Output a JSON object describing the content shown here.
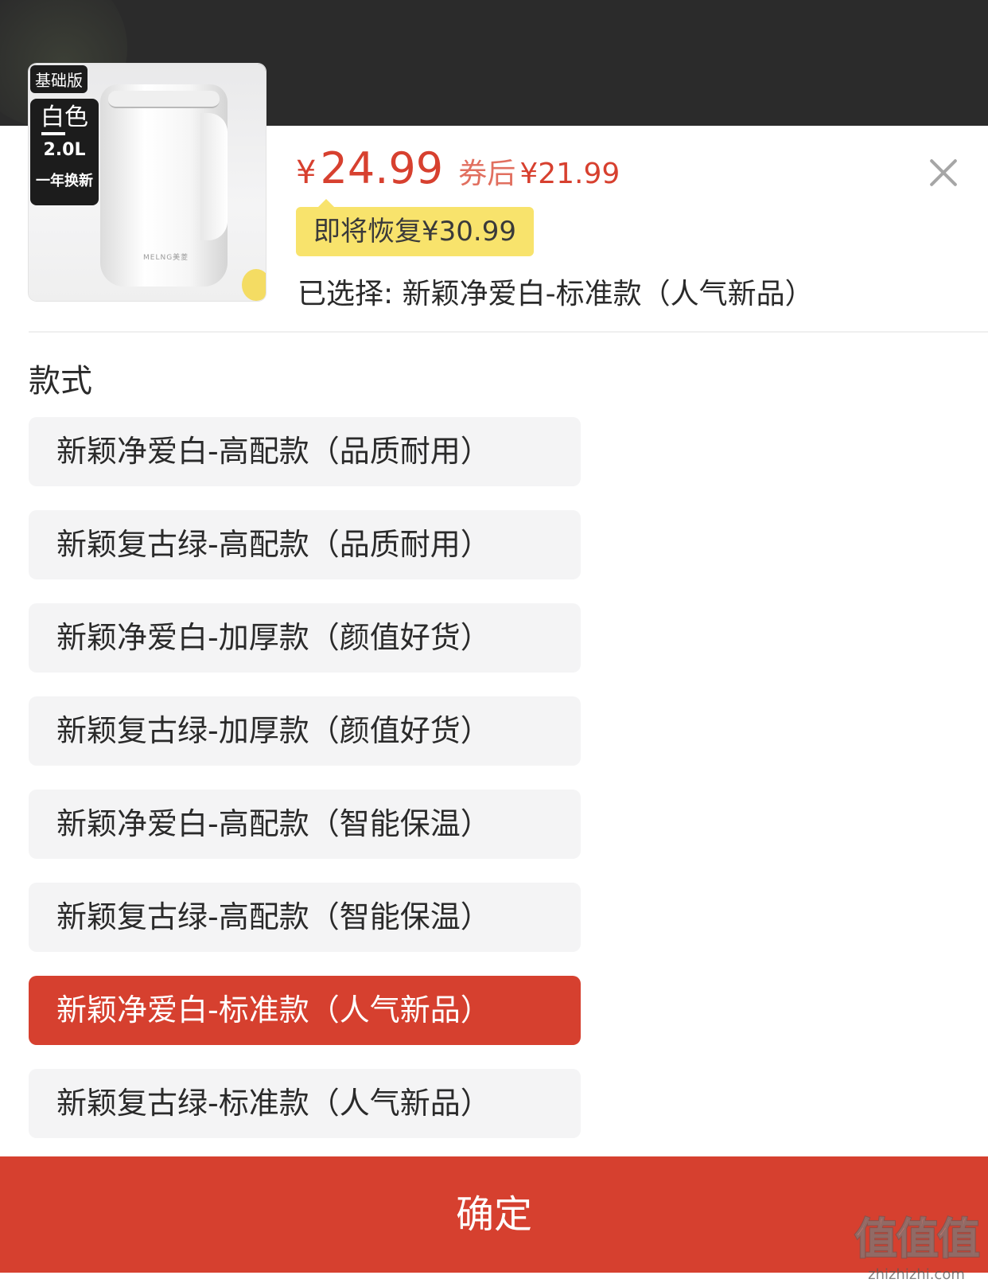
{
  "product": {
    "tag_basic": "基础版",
    "tag_color": "白色",
    "tag_capacity": "2.0L",
    "tag_warranty": "一年换新",
    "brand_mark": "MELNG美菱"
  },
  "price": {
    "symbol": "¥",
    "value": "24.99",
    "coupon_label": "券后",
    "coupon_price": "¥21.99",
    "restore_notice": "即将恢复¥30.99",
    "accent_color": "#d6402f"
  },
  "selection": {
    "label": "已选择: 新颖净爱白-标准款（人气新品）"
  },
  "close": {
    "icon": "close-icon"
  },
  "style_section": {
    "title": "款式",
    "options": [
      {
        "label": "新颖净爱白-高配款（品质耐用）",
        "selected": false
      },
      {
        "label": "新颖复古绿-高配款（品质耐用）",
        "selected": false
      },
      {
        "label": "新颖净爱白-加厚款（颜值好货）",
        "selected": false
      },
      {
        "label": "新颖复古绿-加厚款（颜值好货）",
        "selected": false
      },
      {
        "label": "新颖净爱白-高配款（智能保温）",
        "selected": false
      },
      {
        "label": "新颖复古绿-高配款（智能保温）",
        "selected": false
      },
      {
        "label": "新颖净爱白-标准款（人气新品）",
        "selected": true
      },
      {
        "label": "新颖复古绿-标准款（人气新品）",
        "selected": false
      }
    ]
  },
  "confirm": {
    "label": "确定"
  },
  "watermark": {
    "logo": "值值值",
    "domain": "zhizhizhi.com"
  }
}
